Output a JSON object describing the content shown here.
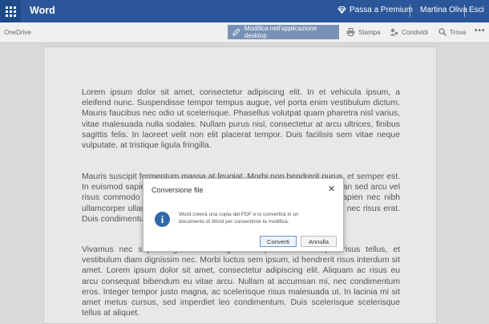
{
  "header": {
    "app_name": "Word",
    "premium_label": "Passa a Premium",
    "user_name": "Martina Oliva",
    "logout_label": "Esci"
  },
  "toolbar": {
    "breadcrumb": "OneDrive",
    "edit_label": "Modifica nell'applicazione desktop",
    "print_label": "Stampa",
    "share_label": "Condividi",
    "find_label": "Trova",
    "more_label": "•••"
  },
  "document": {
    "paragraphs": [
      "Lorem ipsum dolor sit amet, consectetur adipiscing elit. In et vehicula ipsum, a eleifend nunc. Suspendisse tempor tempus augue, vel porta enim vestibulum dictum. Mauris faucibus nec odio ut scelerisque. Phasellus volutpat quam pharetra nisl varius, vitae malesuada nulla sodales. Nullam purus nisl, consectetur at arcu ultrices, finibus sagittis felis. In laoreet velit non elit placerat tempor. Duis facilisis sem vitae neque vulputate, at tristique ligula fringilla.",
      "Mauris suscipit fermentum massa at feugiat. Morbi non hendrerit purus, et semper est. In euismod sapien et nisi vehicula, sit amet ornare feugiat libero. Aenean sed arcu vel risus commodo cursus at et tortis diam ac consectetur. Donec in sapien nec nibh ullamcorper ullamcorper consequat rhoncus vitae ex. Ut volutpat tellus nec risus erat. Duis condimentum sem at luctus.",
      "Vivamus nec sapien eget lectus sagittis semper. Nunc semper risus tellus, et vestibulum diam dignissim nec. Morbi luctus sem ipsum, id hendrerit risus interdum sit amet. Lorem ipsum dolor sit amet, consectetur adipiscing elit. Aliquam ac risus eu arcu consequat bibendum eu vitae arcu. Nullam at accumsan mi, nec condimentum eros. Integer tempor justo magna, ac scelerisque risus malesuada ut. In lacinia mi sit amet metus cursus, sed imperdiet leo condimentum. Duis scelerisque scelerisque tellus at aliquet."
    ]
  },
  "dialog": {
    "title": "Conversione file",
    "close_label": "✕",
    "icon": "info-icon",
    "message": "Word creerà una copia del PDF e lo convertirà in un documento di Word per consentirne la modifica.",
    "ok_label": "Converti",
    "cancel_label": "Annulla"
  },
  "colors": {
    "header_bg": "#2b579a",
    "edit_button_bg": "#7991b7",
    "info_icon": "#2f6aa8"
  }
}
